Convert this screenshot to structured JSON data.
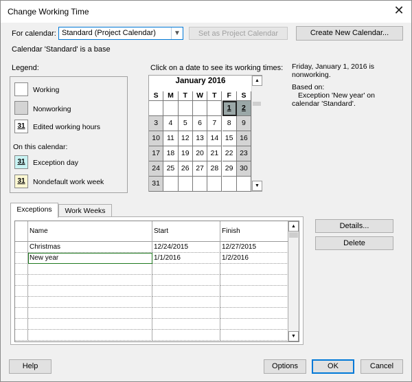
{
  "window": {
    "title": "Change Working Time",
    "close_glyph": "✕"
  },
  "top": {
    "for_calendar_label": "For calendar:",
    "calendar_value": "Standard (Project Calendar)",
    "set_as_project_label": "Set as Project Calendar",
    "create_new_label": "Create New Calendar...",
    "base_note": "Calendar 'Standard' is a base"
  },
  "legend": {
    "title": "Legend:",
    "working": "Working",
    "nonworking": "Nonworking",
    "edited": "Edited working hours",
    "on_this_calendar": "On this calendar:",
    "exception": "Exception day",
    "nondefault": "Nondefault work week",
    "swatch_number": "31",
    "colors": {
      "working": "#ffffff",
      "nonworking": "#d4d4d4",
      "exception": "#c9f3f3",
      "nondefault": "#fbf7d2"
    }
  },
  "calendar": {
    "instruction": "Click on a date to see its working times:",
    "month_title": "January 2016",
    "day_headers": [
      "S",
      "M",
      "T",
      "W",
      "T",
      "F",
      "S"
    ],
    "weeks": [
      [
        "",
        "",
        "",
        "",
        "",
        "1",
        "2"
      ],
      [
        "3",
        "4",
        "5",
        "6",
        "7",
        "8",
        "9"
      ],
      [
        "10",
        "11",
        "12",
        "13",
        "14",
        "15",
        "16"
      ],
      [
        "17",
        "18",
        "19",
        "20",
        "21",
        "22",
        "23"
      ],
      [
        "24",
        "25",
        "26",
        "27",
        "28",
        "29",
        "30"
      ],
      [
        "31",
        "",
        "",
        "",
        "",
        "",
        ""
      ]
    ]
  },
  "info": {
    "date_line": "Friday, January 1, 2016 is nonworking.",
    "based_on": "Based on:",
    "detail": "Exception 'New year' on calendar 'Standard'."
  },
  "tabs": {
    "exceptions": "Exceptions",
    "work_weeks": "Work Weeks"
  },
  "exceptions_table": {
    "headers": {
      "name": "Name",
      "start": "Start",
      "finish": "Finish"
    },
    "rows": [
      {
        "name": "Christmas",
        "start": "12/24/2015",
        "finish": "12/27/2015"
      },
      {
        "name": "New year",
        "start": "1/1/2016",
        "finish": "1/2/2016"
      }
    ]
  },
  "side_buttons": {
    "details": "Details...",
    "delete": "Delete"
  },
  "footer": {
    "help": "Help",
    "options": "Options",
    "ok": "OK",
    "cancel": "Cancel"
  }
}
